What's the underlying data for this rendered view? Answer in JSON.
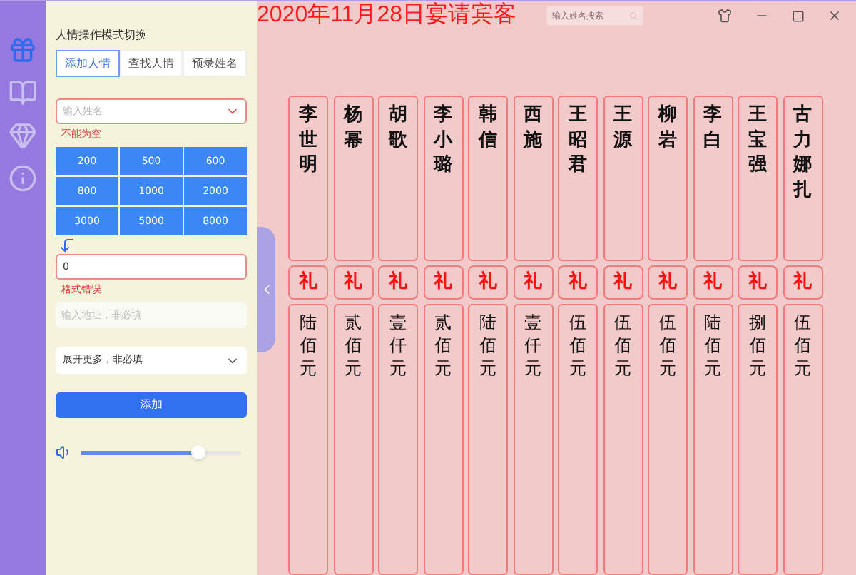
{
  "sidebar": {
    "items": [
      {
        "kind": "gift",
        "selected": true
      },
      {
        "kind": "book",
        "selected": false
      },
      {
        "kind": "diamond",
        "selected": false
      },
      {
        "kind": "info",
        "selected": false
      }
    ]
  },
  "panel": {
    "mode_label": "人情操作模式切换",
    "tabs": [
      {
        "label": "添加人情",
        "selected": true
      },
      {
        "label": "查找人情",
        "selected": false
      },
      {
        "label": "预录姓名",
        "selected": false
      }
    ],
    "name_field": {
      "placeholder": "输入姓名",
      "error": "不能为空"
    },
    "amount_buttons": [
      "200",
      "500",
      "600",
      "800",
      "1000",
      "2000",
      "3000",
      "5000",
      "8000"
    ],
    "amount_field": {
      "value": "0",
      "error": "格式错误"
    },
    "address_field": {
      "placeholder": "输入地址，非必填"
    },
    "more_dropdown": {
      "label": "展开更多，非必填"
    },
    "add_button": "添加",
    "volume": {
      "level": 0.73
    }
  },
  "header": {
    "title": "2020年11月28日宴请宾客",
    "search": {
      "placeholder": "输入姓名搜索"
    }
  },
  "gift_book": {
    "guests": [
      {
        "name": "李世明",
        "gift_mark": "礼",
        "amount": "陆佰元"
      },
      {
        "name": "杨幂",
        "gift_mark": "礼",
        "amount": "贰佰元"
      },
      {
        "name": "胡歌",
        "gift_mark": "礼",
        "amount": "壹仟元"
      },
      {
        "name": "李小璐",
        "gift_mark": "礼",
        "amount": "贰佰元"
      },
      {
        "name": "韩信",
        "gift_mark": "礼",
        "amount": "陆佰元"
      },
      {
        "name": "西施",
        "gift_mark": "礼",
        "amount": "壹仟元"
      },
      {
        "name": "王昭君",
        "gift_mark": "礼",
        "amount": "伍佰元"
      },
      {
        "name": "王源",
        "gift_mark": "礼",
        "amount": "伍佰元"
      },
      {
        "name": "柳岩",
        "gift_mark": "礼",
        "amount": "伍佰元"
      },
      {
        "name": "李白",
        "gift_mark": "礼",
        "amount": "陆佰元"
      },
      {
        "name": "王宝强",
        "gift_mark": "礼",
        "amount": "捌佰元"
      },
      {
        "name": "古力娜扎",
        "gift_mark": "礼",
        "amount": "伍佰元"
      }
    ]
  }
}
